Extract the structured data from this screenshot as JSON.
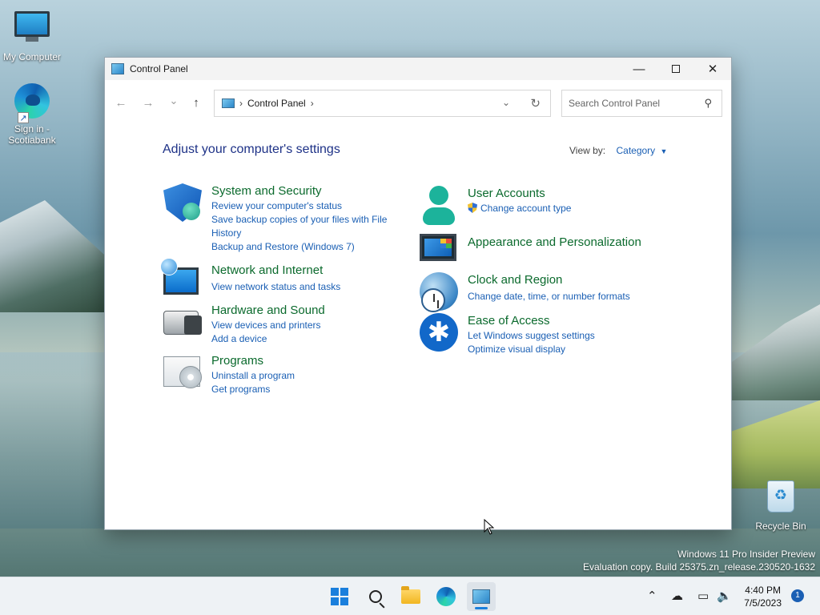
{
  "desktop": {
    "icons": [
      {
        "label": "My Computer",
        "icon": "computer-icon"
      },
      {
        "label": "Sign in - Scotiabank",
        "icon": "edge-icon"
      },
      {
        "label": "Recycle Bin",
        "icon": "recycle-bin-icon"
      }
    ],
    "watermark": {
      "line1": "Windows 11 Pro Insider Preview",
      "line2": "Evaluation copy. Build 25375.zn_release.230520-1632"
    }
  },
  "window": {
    "title": "Control Panel",
    "controls": {
      "minimize": "—",
      "close": "✕"
    },
    "nav": {
      "back": "←",
      "forward": "→",
      "recent": "⌄",
      "up": "↑"
    },
    "address": {
      "path": "Control Panel"
    },
    "search": {
      "placeholder": "Search Control Panel"
    },
    "heading": "Adjust your computer's settings",
    "view_by": {
      "label": "View by:",
      "value": "Category"
    },
    "categories_left": [
      {
        "title": "System and Security",
        "icon": "shield-icon",
        "links": [
          "Review your computer's status",
          "Save backup copies of your files with File History",
          "Backup and Restore (Windows 7)"
        ]
      },
      {
        "title": "Network and Internet",
        "icon": "network-icon",
        "links": [
          "View network status and tasks"
        ]
      },
      {
        "title": "Hardware and Sound",
        "icon": "printer-speaker-icon",
        "links": [
          "View devices and printers",
          "Add a device"
        ]
      },
      {
        "title": "Programs",
        "icon": "programs-icon",
        "links": [
          "Uninstall a program",
          "Get programs"
        ]
      }
    ],
    "categories_right": [
      {
        "title": "User Accounts",
        "icon": "user-icon",
        "links": [
          "Change account type"
        ]
      },
      {
        "title": "Appearance and Personalization",
        "icon": "monitor-icon",
        "links": []
      },
      {
        "title": "Clock and Region",
        "icon": "clock-globe-icon",
        "links": [
          "Change date, time, or number formats"
        ]
      },
      {
        "title": "Ease of Access",
        "icon": "accessibility-icon",
        "links": [
          "Let Windows suggest settings",
          "Optimize visual display"
        ]
      }
    ]
  },
  "taskbar": {
    "time": "4:40 PM",
    "date": "7/5/2023",
    "notification_count": "1"
  }
}
